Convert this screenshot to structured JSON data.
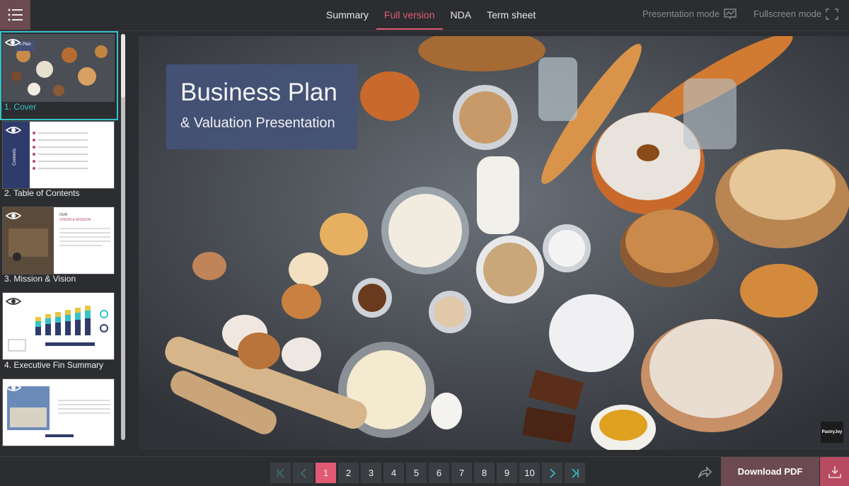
{
  "header": {
    "tabs": [
      {
        "label": "Summary"
      },
      {
        "label": "Full version"
      },
      {
        "label": "NDA"
      },
      {
        "label": "Term sheet"
      }
    ],
    "presentation_mode": "Presentation mode",
    "fullscreen_mode": "Fullscreen mode"
  },
  "sidebar": {
    "items": [
      {
        "label": "1. Cover"
      },
      {
        "label": "2. Table of Contents"
      },
      {
        "label": "3. Mission & Vision"
      },
      {
        "label": "4. Executive Fin Summary"
      },
      {
        "label": ""
      }
    ],
    "thumb_texts": {
      "cover_fragment": "s Plan",
      "contents": "Contents",
      "mission_our": "OUR",
      "mission_title": "VISION & MISSION"
    }
  },
  "slide": {
    "title": "Business Plan",
    "subtitle": "& Valuation Presentation",
    "watermark": "PastryJoy"
  },
  "pager": {
    "pages": [
      "1",
      "2",
      "3",
      "4",
      "5",
      "6",
      "7",
      "8",
      "9",
      "10"
    ],
    "current": "1"
  },
  "footer": {
    "download_label": "Download PDF"
  },
  "colors": {
    "accent": "#e05a74",
    "selection": "#36c1c9",
    "title_box": "#445278",
    "download_bg": "#6b4a52"
  }
}
